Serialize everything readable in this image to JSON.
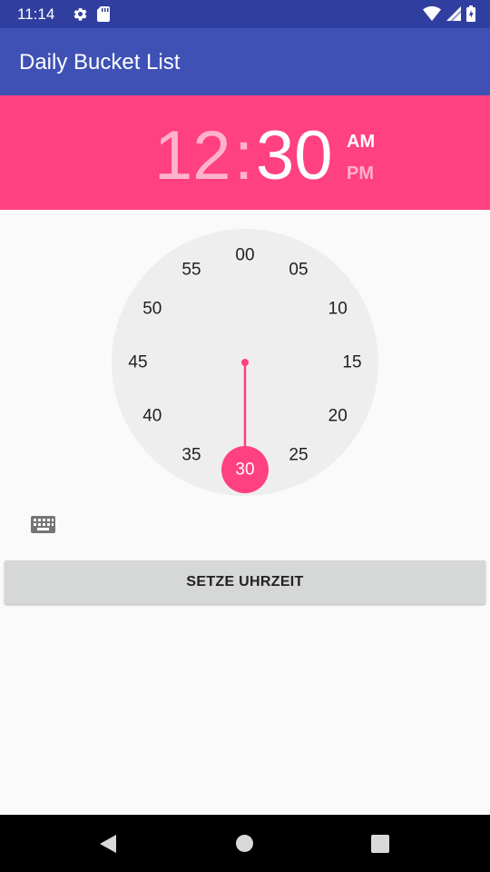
{
  "status_bar": {
    "time": "11:14",
    "icons": [
      "gear-icon",
      "sd-card-icon",
      "wifi-icon",
      "signal-icon",
      "battery-icon"
    ]
  },
  "app_bar": {
    "title": "Daily Bucket List"
  },
  "time_picker": {
    "hour": "12",
    "separator": ":",
    "minute": "30",
    "am_label": "AM",
    "pm_label": "PM",
    "selected_period": "AM",
    "dial_labels": [
      "00",
      "05",
      "10",
      "15",
      "20",
      "25",
      "30",
      "35",
      "40",
      "45",
      "50",
      "55"
    ],
    "selected_minute": "30",
    "accent_color": "#ff4081"
  },
  "keyboard_toggle": {
    "icon": "keyboard-icon"
  },
  "set_button": {
    "label": "SETZE UHRZEIT"
  },
  "colors": {
    "status_bar": "#303f9f",
    "app_bar": "#3f51b5",
    "accent": "#ff4081",
    "dial": "#eeeeee"
  }
}
